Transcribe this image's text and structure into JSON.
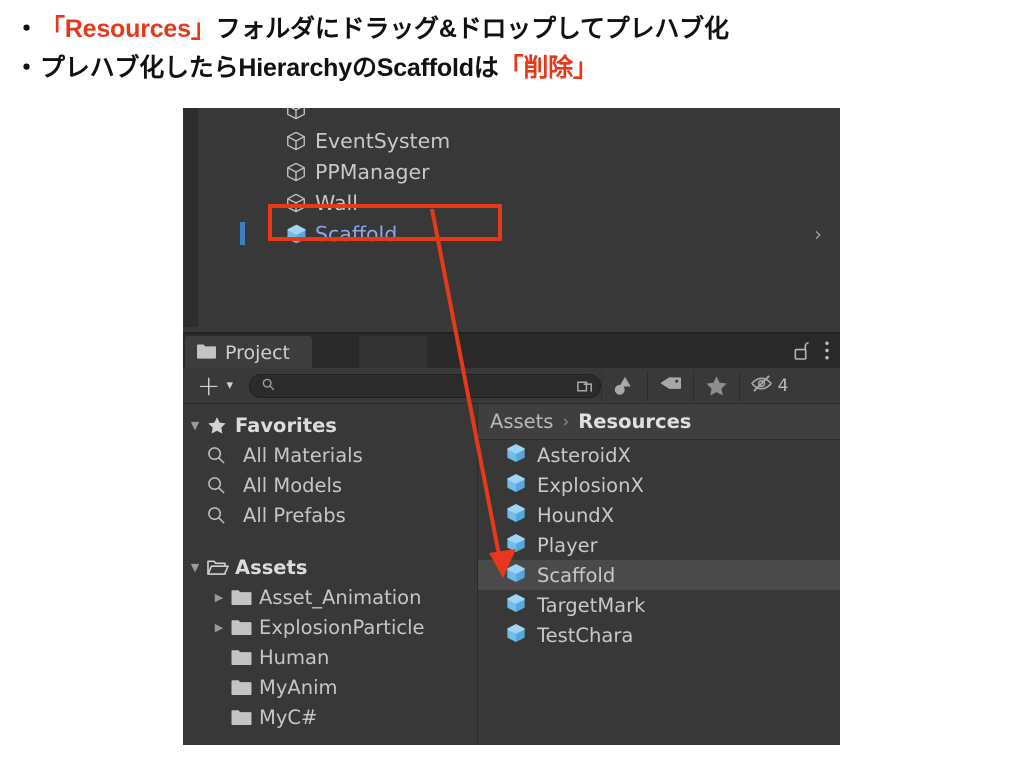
{
  "slide": {
    "bullets": [
      {
        "mark": "・",
        "segments": [
          {
            "text": "「Resources」",
            "highlight": true
          },
          {
            "text": "フォルダにドラッグ&ドロップしてプレハブ化",
            "highlight": false
          }
        ]
      },
      {
        "mark": "・",
        "segments": [
          {
            "text": "プレハブ化したらHierarchyのScaffoldは",
            "highlight": false
          },
          {
            "text": "「削除」",
            "highlight": true
          }
        ]
      }
    ],
    "accent_color": "#e8381b"
  },
  "hierarchy": {
    "rows": [
      {
        "label": "",
        "icon": "cube-outline-icon",
        "selected": false,
        "partial": true
      },
      {
        "label": "EventSystem",
        "icon": "cube-outline-icon",
        "selected": false
      },
      {
        "label": "PPManager",
        "icon": "cube-outline-icon",
        "selected": false
      },
      {
        "label": "Wall",
        "icon": "cube-outline-icon",
        "selected": false
      },
      {
        "label": "Scaffold",
        "icon": "cube-blue-icon",
        "selected": true,
        "chevron": "›"
      }
    ],
    "selection_color": "#8ea6e8"
  },
  "project": {
    "tab": {
      "label": "Project",
      "icon": "folder-icon"
    },
    "window_controls": {
      "lock": "lock-open-icon",
      "menu": "kebab-menu-icon"
    },
    "toolbar": {
      "create_label": "+",
      "create_dropdown": "▾",
      "search": {
        "value": "",
        "placeholder": ""
      },
      "buttons": [
        {
          "name": "search-by-type-icon",
          "label": ""
        },
        {
          "name": "search-by-label-icon",
          "label": ""
        },
        {
          "name": "favorite-star-icon",
          "label": ""
        },
        {
          "name": "hidden-packages-icon",
          "label": "4"
        }
      ]
    },
    "tree": {
      "favorites": {
        "label": "Favorites",
        "expanded": true,
        "items": [
          {
            "label": "All Materials",
            "icon": "search-icon"
          },
          {
            "label": "All Models",
            "icon": "search-icon"
          },
          {
            "label": "All Prefabs",
            "icon": "search-icon"
          }
        ]
      },
      "assets": {
        "label": "Assets",
        "expanded": true,
        "items": [
          {
            "label": "Asset_Animation",
            "icon": "folder-icon",
            "expandable": true
          },
          {
            "label": "ExplosionParticle",
            "icon": "folder-icon",
            "expandable": true
          },
          {
            "label": "Human",
            "icon": "folder-icon",
            "expandable": false
          },
          {
            "label": "MyAnim",
            "icon": "folder-icon",
            "expandable": false
          },
          {
            "label": "MyC#",
            "icon": "folder-icon",
            "expandable": false
          }
        ]
      }
    },
    "breadcrumb": {
      "root": "Assets",
      "separator": "›",
      "current": "Resources"
    },
    "assets": [
      {
        "label": "AsteroidX",
        "icon": "prefab-cube-icon",
        "selected": false
      },
      {
        "label": "ExplosionX",
        "icon": "prefab-cube-icon",
        "selected": false
      },
      {
        "label": "HoundX",
        "icon": "prefab-cube-icon",
        "selected": false
      },
      {
        "label": "Player",
        "icon": "prefab-cube-icon",
        "selected": false
      },
      {
        "label": "Scaffold",
        "icon": "prefab-cube-icon",
        "selected": true
      },
      {
        "label": "TargetMark",
        "icon": "prefab-cube-icon",
        "selected": false
      },
      {
        "label": "TestChara",
        "icon": "prefab-cube-icon",
        "selected": false
      }
    ]
  }
}
